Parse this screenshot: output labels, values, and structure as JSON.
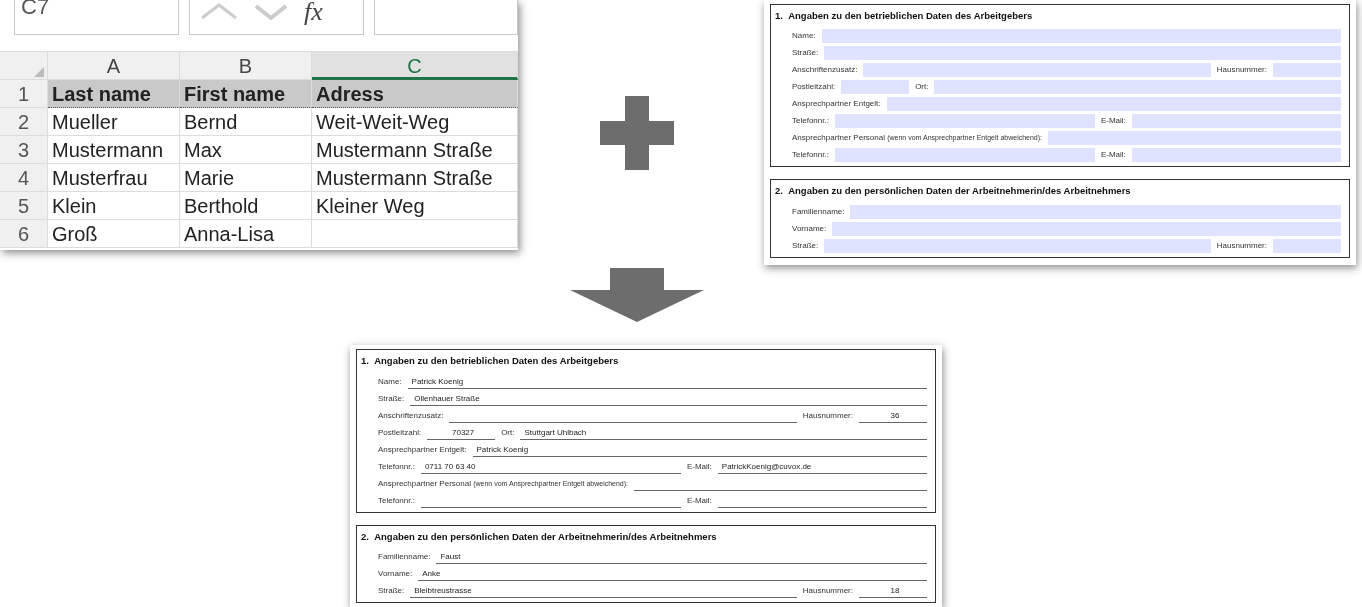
{
  "spreadsheet": {
    "name_box": "C7",
    "function_label": "fx",
    "columns": [
      {
        "letter": "A",
        "selected": false
      },
      {
        "letter": "B",
        "selected": false
      },
      {
        "letter": "C",
        "selected": true
      }
    ],
    "rows": [
      {
        "number": "1",
        "header": true,
        "cells": [
          "Last name",
          "First name",
          "Adress"
        ]
      },
      {
        "number": "2",
        "header": false,
        "cells": [
          "Mueller",
          "Bernd",
          "Weit-Weit-Weg"
        ]
      },
      {
        "number": "3",
        "header": false,
        "cells": [
          "Mustermann",
          "Max",
          "Mustermann Straße"
        ]
      },
      {
        "number": "4",
        "header": false,
        "cells": [
          "Musterfrau",
          "Marie",
          "Mustermann Straße"
        ]
      },
      {
        "number": "5",
        "header": false,
        "cells": [
          "Klein",
          "Berthold",
          "Kleiner Weg"
        ]
      },
      {
        "number": "6",
        "header": false,
        "cells": [
          "Groß",
          "Anna-Lisa",
          ""
        ]
      }
    ]
  },
  "forms": [
    {
      "kind": "template",
      "sections": [
        {
          "number": "1.",
          "title": "Angaben zu den betrieblichen Daten des Arbeitgebers",
          "rows": [
            [
              {
                "label": "Name:",
                "kind": "fill"
              }
            ],
            [
              {
                "label": "Straße:",
                "kind": "fill"
              }
            ],
            [
              {
                "label": "Anschriftenzusatz:",
                "kind": "fill"
              },
              {
                "label": "Hausnummer:",
                "kind": "short"
              }
            ],
            [
              {
                "label": "Postleitzahl:",
                "kind": "short"
              },
              {
                "label": "Ort:",
                "kind": "fill"
              }
            ],
            [
              {
                "label": "Ansprechpartner Entgelt:",
                "kind": "fill"
              }
            ],
            [
              {
                "label": "Telefonnr.:",
                "kind": "half"
              },
              {
                "label": "E-Mail:",
                "kind": "fill"
              }
            ],
            [
              {
                "label": "Ansprechpartner Personal",
                "note": "(wenn vom Ansprechpartner Entgelt abweichend):",
                "kind": "fill"
              }
            ],
            [
              {
                "label": "Telefonnr.:",
                "kind": "half"
              },
              {
                "label": "E-Mail:",
                "kind": "fill"
              }
            ]
          ]
        },
        {
          "number": "2.",
          "title": "Angaben zu den persönlichen Daten der Arbeitnehmerin/des Arbeitnehmers",
          "rows": [
            [
              {
                "label": "Familienname:",
                "kind": "fill"
              }
            ],
            [
              {
                "label": "Vorname:",
                "kind": "fill"
              }
            ],
            [
              {
                "label": "Straße:",
                "kind": "fill"
              },
              {
                "label": "Hausnummer:",
                "kind": "short"
              }
            ]
          ]
        }
      ]
    },
    {
      "kind": "filled",
      "sections": [
        {
          "number": "1.",
          "title": "Angaben zu den betrieblichen Daten des Arbeitgebers",
          "rows": [
            [
              {
                "label": "Name:",
                "kind": "fill",
                "value": "Patrick Koenig"
              }
            ],
            [
              {
                "label": "Straße:",
                "kind": "fill",
                "value": "Ollenhauer Straße"
              }
            ],
            [
              {
                "label": "Anschriftenzusatz:",
                "kind": "fill"
              },
              {
                "label": "Hausnummer:",
                "kind": "short",
                "value": "36"
              }
            ],
            [
              {
                "label": "Postleitzahl:",
                "kind": "short",
                "value": "70327"
              },
              {
                "label": "Ort:",
                "kind": "fill",
                "value": "Stuttgart Uhlbach"
              }
            ],
            [
              {
                "label": "Ansprechpartner Entgelt:",
                "kind": "fill",
                "value": "Patrick Koenig"
              }
            ],
            [
              {
                "label": "Telefonnr.:",
                "kind": "half",
                "value": "0711 70 63 40"
              },
              {
                "label": "E-Mail:",
                "kind": "fill",
                "value": "PatrickKoenig@cuvox.de"
              }
            ],
            [
              {
                "label": "Ansprechpartner Personal",
                "note": "(wenn vom Ansprechpartner Entgelt abweichend):",
                "kind": "fill"
              }
            ],
            [
              {
                "label": "Telefonnr.:",
                "kind": "half"
              },
              {
                "label": "E-Mail:",
                "kind": "fill"
              }
            ]
          ]
        },
        {
          "number": "2.",
          "title": "Angaben zu den persönlichen Daten der Arbeitnehmerin/des Arbeitnehmers",
          "rows": [
            [
              {
                "label": "Familienname:",
                "kind": "fill",
                "value": "Faust"
              }
            ],
            [
              {
                "label": "Vorname:",
                "kind": "fill",
                "value": "Anke"
              }
            ],
            [
              {
                "label": "Straße:",
                "kind": "fill",
                "value": "Bleibtreustrasse"
              },
              {
                "label": "Hausnummer:",
                "kind": "short",
                "value": "18"
              }
            ]
          ]
        }
      ]
    }
  ]
}
